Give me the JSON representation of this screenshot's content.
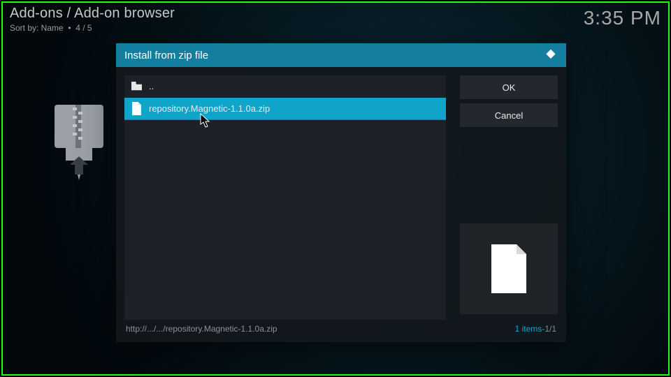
{
  "header": {
    "breadcrumb": "Add-ons / Add-on browser",
    "sort_label": "Sort by: Name",
    "sort_sep": "•",
    "sort_pos": "4 / 5",
    "clock": "3:35 PM"
  },
  "dialog": {
    "title": "Install from zip file",
    "rows": [
      {
        "icon": "folder",
        "label": ".."
      },
      {
        "icon": "file",
        "label": "repository.Magnetic-1.1.0a.zip",
        "selected": true
      }
    ],
    "ok_label": "OK",
    "cancel_label": "Cancel",
    "path": "http://.../.../repository.Magnetic-1.1.0a.zip",
    "count_label": "1 items",
    "count_sep": " - ",
    "count_pos": "1/1"
  }
}
